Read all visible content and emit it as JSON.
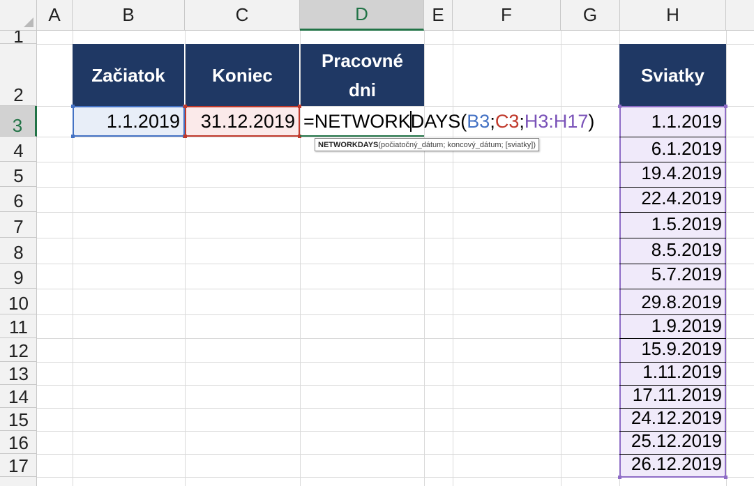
{
  "columns": [
    "A",
    "B",
    "C",
    "D",
    "E",
    "F",
    "G",
    "H"
  ],
  "active_column": "D",
  "rows": [
    "1",
    "2",
    "3",
    "4",
    "5",
    "6",
    "7",
    "8",
    "9",
    "10",
    "11",
    "12",
    "13",
    "14",
    "15",
    "16",
    "17"
  ],
  "active_row": "3",
  "table": {
    "header_start": "Začiatok",
    "header_end": "Koniec",
    "header_workdays_line1": "Pracovné",
    "header_workdays_line2": "dni",
    "start_date": "1.1.2019",
    "end_date": "31.12.2019"
  },
  "holidays": {
    "header": "Sviatky",
    "dates": [
      "1.1.2019",
      "6.1.2019",
      "19.4.2019",
      "22.4.2019",
      "1.5.2019",
      "8.5.2019",
      "5.7.2019",
      "29.8.2019",
      "1.9.2019",
      "15.9.2019",
      "1.11.2019",
      "17.11.2019",
      "24.12.2019",
      "25.12.2019",
      "26.12.2019"
    ]
  },
  "formula": {
    "prefix": "=NETWORK",
    "func_rest": "DAYS(",
    "arg1": "B3",
    "sep1": ";",
    "arg2": "C3",
    "sep2": ";",
    "arg3": "H3:H17",
    "close": ")"
  },
  "tooltip": {
    "function_name": "NETWORKDAYS",
    "args": "(počiatočný_dátum; koncový_dátum; [sviatky])"
  },
  "colors": {
    "header_bg": "#1f3864",
    "ref_b": "#4472c4",
    "ref_c": "#c0392b",
    "ref_h": "#7a52b8",
    "active_header": "#217346"
  }
}
